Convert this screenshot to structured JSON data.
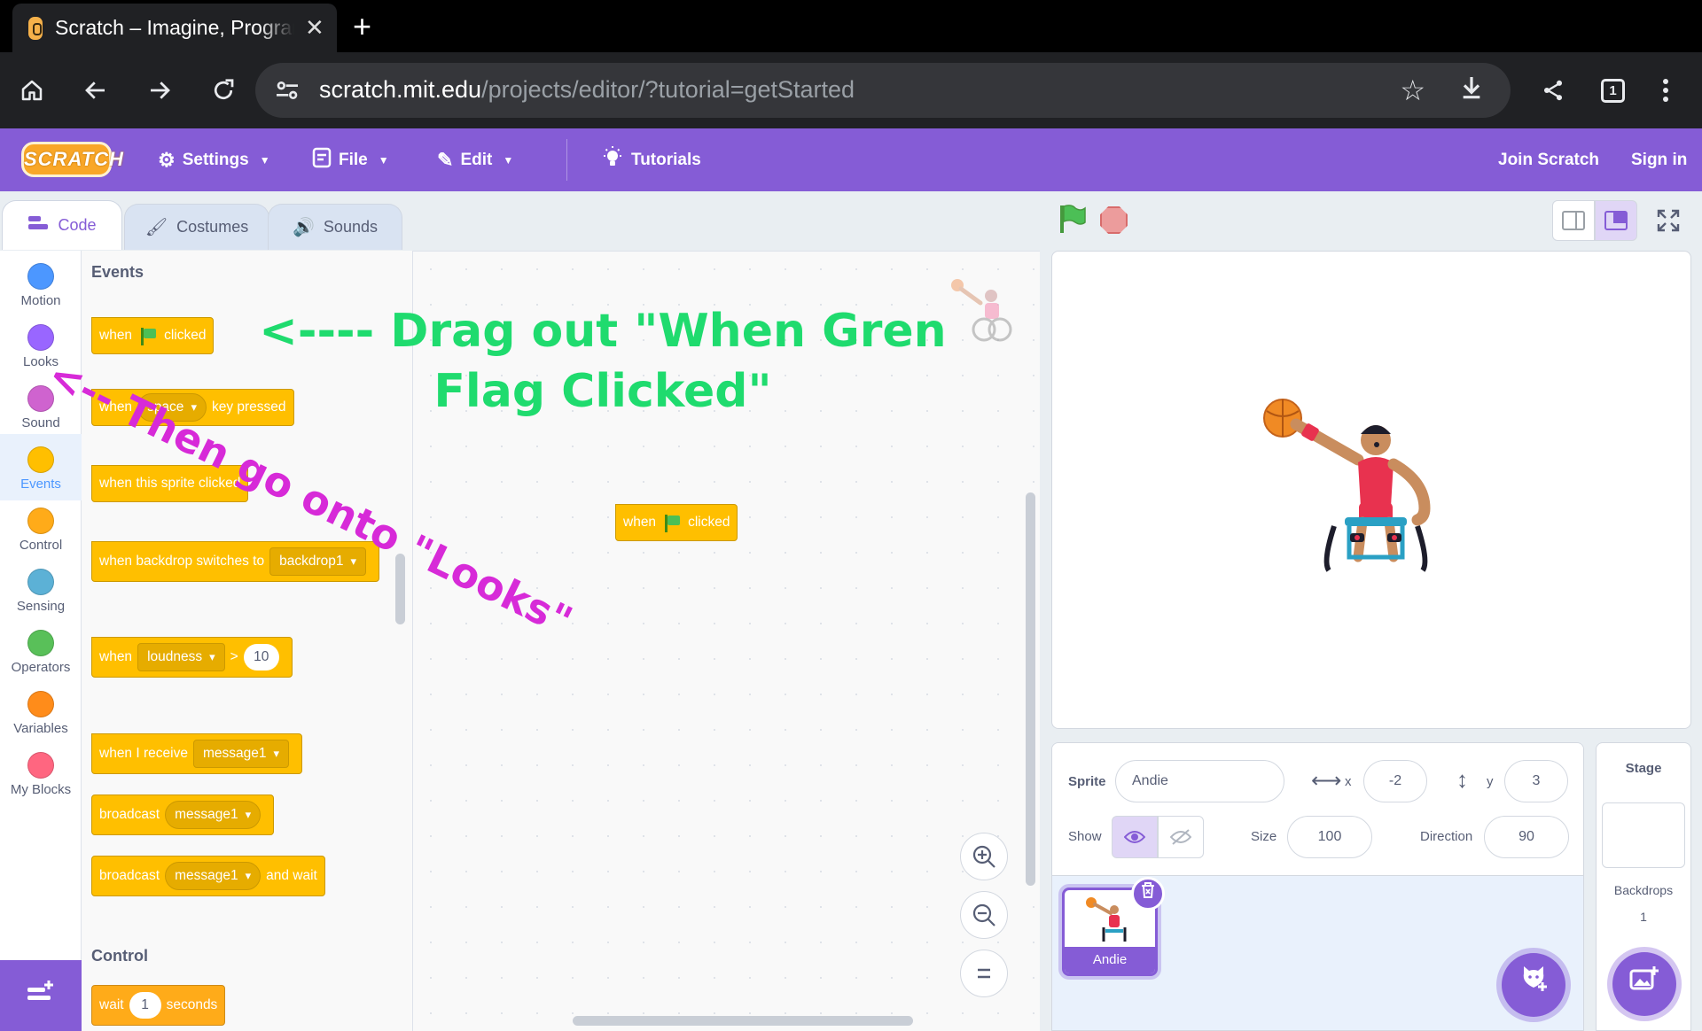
{
  "browser": {
    "tab_title": "Scratch – Imagine, Program, Share",
    "tab_close": "✕",
    "new_tab": "+",
    "url_host": "scratch.mit.edu",
    "url_path": "/projects/editor/?tutorial=getStarted",
    "tab_count": "1"
  },
  "menubar": {
    "logo": "SCRATCH",
    "settings": "Settings",
    "file": "File",
    "edit": "Edit",
    "tutorials": "Tutorials",
    "join": "Join Scratch",
    "signin": "Sign in"
  },
  "tabs": {
    "code": "Code",
    "costumes": "Costumes",
    "sounds": "Sounds"
  },
  "categories": [
    {
      "label": "Motion",
      "color": "#4c97ff"
    },
    {
      "label": "Looks",
      "color": "#9966ff"
    },
    {
      "label": "Sound",
      "color": "#cf63cf"
    },
    {
      "label": "Events",
      "color": "#ffbf00"
    },
    {
      "label": "Control",
      "color": "#ffab19"
    },
    {
      "label": "Sensing",
      "color": "#5cb1d6"
    },
    {
      "label": "Operators",
      "color": "#59c059"
    },
    {
      "label": "Variables",
      "color": "#ff8c1a"
    },
    {
      "label": "My Blocks",
      "color": "#ff6680"
    }
  ],
  "palette": {
    "events_heading": "Events",
    "control_heading": "Control",
    "b_flag": {
      "when": "when",
      "clicked": "clicked"
    },
    "b_key": {
      "when": "when",
      "key": "space",
      "rest": "key pressed"
    },
    "b_sprite": "when this sprite clicked",
    "b_backdrop": {
      "text": "when backdrop switches to",
      "dd": "backdrop1"
    },
    "b_loud": {
      "when": "when",
      "dd": "loudness",
      "op": ">",
      "num": "10"
    },
    "b_receive": {
      "text": "when I receive",
      "dd": "message1"
    },
    "b_broadcast": {
      "text": "broadcast",
      "dd": "message1"
    },
    "b_broadcast_wait": {
      "text": "broadcast",
      "dd": "message1",
      "tail": "and wait"
    },
    "b_wait": {
      "text": "wait",
      "num": "1",
      "tail": "seconds"
    }
  },
  "script": {
    "when": "when",
    "clicked": "clicked"
  },
  "annotations": {
    "flag": "<---- Drag out \"When Gren Flag Clicked\"",
    "looks": "<-- Then go onto \"Looks\""
  },
  "sprite_info": {
    "sprite_label": "Sprite",
    "sprite_name": "Andie",
    "x_label": "x",
    "x": "-2",
    "y_label": "y",
    "y": "3",
    "show_label": "Show",
    "size_label": "Size",
    "size": "100",
    "direction_label": "Direction",
    "direction": "90",
    "thumb_name": "Andie"
  },
  "stage_pane": {
    "title": "Stage",
    "backdrops_label": "Backdrops",
    "backdrops_count": "1"
  },
  "colors": {
    "accent": "#855cd6",
    "events": "#ffbf00",
    "annotation_green": "#1fdb6e",
    "annotation_magenta": "#d72ad8"
  }
}
